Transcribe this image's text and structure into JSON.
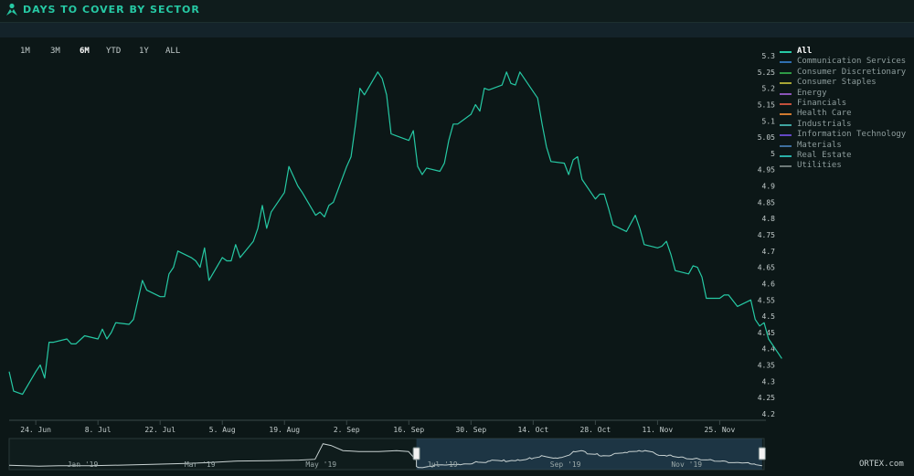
{
  "header": {
    "title": "DAYS TO COVER BY SECTOR"
  },
  "range_buttons": [
    {
      "label": "1M",
      "active": false
    },
    {
      "label": "3M",
      "active": false
    },
    {
      "label": "6M",
      "active": true
    },
    {
      "label": "YTD",
      "active": false
    },
    {
      "label": "1Y",
      "active": false
    },
    {
      "label": "ALL",
      "active": false
    }
  ],
  "legend": [
    {
      "label": "All",
      "color": "#26c9a4",
      "active": true
    },
    {
      "label": "Communication Services",
      "color": "#2f6fb0",
      "active": false
    },
    {
      "label": "Consumer Discretionary",
      "color": "#2e9a46",
      "active": false
    },
    {
      "label": "Consumer Staples",
      "color": "#a8a535",
      "active": false
    },
    {
      "label": "Energy",
      "color": "#8a54b8",
      "active": false
    },
    {
      "label": "Financials",
      "color": "#c2503c",
      "active": false
    },
    {
      "label": "Health Care",
      "color": "#d07a2f",
      "active": false
    },
    {
      "label": "Industrials",
      "color": "#3fa5a0",
      "active": false
    },
    {
      "label": "Information Technology",
      "color": "#6348c4",
      "active": false
    },
    {
      "label": "Materials",
      "color": "#3e6f9f",
      "active": false
    },
    {
      "label": "Real Estate",
      "color": "#2ab0a8",
      "active": false
    },
    {
      "label": "Utilities",
      "color": "#6f7a78",
      "active": false
    }
  ],
  "chart_data": {
    "type": "line",
    "title": "DAYS TO COVER BY SECTOR",
    "xlabel": "",
    "ylabel": "",
    "ylim": [
      4.2,
      5.3
    ],
    "yticks": [
      4.2,
      4.25,
      4.3,
      4.35,
      4.4,
      4.45,
      4.5,
      4.55,
      4.6,
      4.65,
      4.7,
      4.75,
      4.8,
      4.85,
      4.9,
      4.95,
      5,
      5.05,
      5.1,
      5.15,
      5.2,
      5.25,
      5.3
    ],
    "ytick_labels": [
      "4.2",
      "4.25",
      "4.3",
      "4.35",
      "4.4",
      "4.45",
      "4.5",
      "4.55",
      "4.6",
      "4.65",
      "4.7",
      "4.75",
      "4.8",
      "4.85",
      "4.9",
      "4.95",
      "5",
      "5.05",
      "5.1",
      "5.15",
      "5.2",
      "5.25",
      "5.3"
    ],
    "xlim": [
      "2019-06-18",
      "2019-12-05"
    ],
    "x_ticks": [
      {
        "label": "24. Jun",
        "date": "2019-06-24"
      },
      {
        "label": "8. Jul",
        "date": "2019-07-08"
      },
      {
        "label": "22. Jul",
        "date": "2019-07-22"
      },
      {
        "label": "5. Aug",
        "date": "2019-08-05"
      },
      {
        "label": "19. Aug",
        "date": "2019-08-19"
      },
      {
        "label": "2. Sep",
        "date": "2019-09-02"
      },
      {
        "label": "16. Sep",
        "date": "2019-09-16"
      },
      {
        "label": "30. Sep",
        "date": "2019-09-30"
      },
      {
        "label": "14. Oct",
        "date": "2019-10-14"
      },
      {
        "label": "28. Oct",
        "date": "2019-10-28"
      },
      {
        "label": "11. Nov",
        "date": "2019-11-11"
      },
      {
        "label": "25. Nov",
        "date": "2019-11-25"
      }
    ],
    "grid": false,
    "legend_position": "right",
    "series": [
      {
        "name": "All",
        "color": "#26c9a4",
        "points": [
          [
            "2019-06-18",
            4.33
          ],
          [
            "2019-06-19",
            4.27
          ],
          [
            "2019-06-20",
            4.265
          ],
          [
            "2019-06-21",
            4.26
          ],
          [
            "2019-06-24",
            4.33
          ],
          [
            "2019-06-25",
            4.35
          ],
          [
            "2019-06-26",
            4.31
          ],
          [
            "2019-06-27",
            4.42
          ],
          [
            "2019-06-28",
            4.42
          ],
          [
            "2019-07-01",
            4.43
          ],
          [
            "2019-07-02",
            4.415
          ],
          [
            "2019-07-03",
            4.415
          ],
          [
            "2019-07-05",
            4.44
          ],
          [
            "2019-07-08",
            4.43
          ],
          [
            "2019-07-09",
            4.46
          ],
          [
            "2019-07-10",
            4.43
          ],
          [
            "2019-07-11",
            4.45
          ],
          [
            "2019-07-12",
            4.48
          ],
          [
            "2019-07-15",
            4.475
          ],
          [
            "2019-07-16",
            4.49
          ],
          [
            "2019-07-17",
            4.55
          ],
          [
            "2019-07-18",
            4.61
          ],
          [
            "2019-07-19",
            4.58
          ],
          [
            "2019-07-22",
            4.56
          ],
          [
            "2019-07-23",
            4.56
          ],
          [
            "2019-07-24",
            4.63
          ],
          [
            "2019-07-25",
            4.65
          ],
          [
            "2019-07-26",
            4.7
          ],
          [
            "2019-07-29",
            4.68
          ],
          [
            "2019-07-30",
            4.67
          ],
          [
            "2019-07-31",
            4.65
          ],
          [
            "2019-08-01",
            4.71
          ],
          [
            "2019-08-02",
            4.61
          ],
          [
            "2019-08-05",
            4.68
          ],
          [
            "2019-08-06",
            4.67
          ],
          [
            "2019-08-07",
            4.67
          ],
          [
            "2019-08-08",
            4.72
          ],
          [
            "2019-08-09",
            4.68
          ],
          [
            "2019-08-12",
            4.73
          ],
          [
            "2019-08-13",
            4.77
          ],
          [
            "2019-08-14",
            4.84
          ],
          [
            "2019-08-15",
            4.77
          ],
          [
            "2019-08-16",
            4.82
          ],
          [
            "2019-08-19",
            4.88
          ],
          [
            "2019-08-20",
            4.96
          ],
          [
            "2019-08-21",
            4.93
          ],
          [
            "2019-08-22",
            4.9
          ],
          [
            "2019-08-23",
            4.88
          ],
          [
            "2019-08-26",
            4.81
          ],
          [
            "2019-08-27",
            4.82
          ],
          [
            "2019-08-28",
            4.805
          ],
          [
            "2019-08-29",
            4.84
          ],
          [
            "2019-08-30",
            4.85
          ],
          [
            "2019-09-02",
            4.96
          ],
          [
            "2019-09-03",
            4.99
          ],
          [
            "2019-09-04",
            5.09
          ],
          [
            "2019-09-05",
            5.2
          ],
          [
            "2019-09-06",
            5.18
          ],
          [
            "2019-09-09",
            5.25
          ],
          [
            "2019-09-10",
            5.23
          ],
          [
            "2019-09-11",
            5.18
          ],
          [
            "2019-09-12",
            5.06
          ],
          [
            "2019-09-13",
            5.055
          ],
          [
            "2019-09-16",
            5.04
          ],
          [
            "2019-09-17",
            5.07
          ],
          [
            "2019-09-18",
            4.96
          ],
          [
            "2019-09-19",
            4.935
          ],
          [
            "2019-09-20",
            4.955
          ],
          [
            "2019-09-23",
            4.945
          ],
          [
            "2019-09-24",
            4.97
          ],
          [
            "2019-09-25",
            5.04
          ],
          [
            "2019-09-26",
            5.09
          ],
          [
            "2019-09-27",
            5.09
          ],
          [
            "2019-09-30",
            5.12
          ],
          [
            "2019-10-01",
            5.15
          ],
          [
            "2019-10-02",
            5.13
          ],
          [
            "2019-10-03",
            5.2
          ],
          [
            "2019-10-04",
            5.195
          ],
          [
            "2019-10-07",
            5.21
          ],
          [
            "2019-10-08",
            5.25
          ],
          [
            "2019-10-09",
            5.215
          ],
          [
            "2019-10-10",
            5.21
          ],
          [
            "2019-10-11",
            5.25
          ],
          [
            "2019-10-14",
            5.19
          ],
          [
            "2019-10-15",
            5.17
          ],
          [
            "2019-10-16",
            5.09
          ],
          [
            "2019-10-17",
            5.02
          ],
          [
            "2019-10-18",
            4.975
          ],
          [
            "2019-10-21",
            4.97
          ],
          [
            "2019-10-22",
            4.935
          ],
          [
            "2019-10-23",
            4.98
          ],
          [
            "2019-10-24",
            4.99
          ],
          [
            "2019-10-25",
            4.92
          ],
          [
            "2019-10-28",
            4.86
          ],
          [
            "2019-10-29",
            4.875
          ],
          [
            "2019-10-30",
            4.875
          ],
          [
            "2019-10-31",
            4.83
          ],
          [
            "2019-11-01",
            4.78
          ],
          [
            "2019-11-04",
            4.76
          ],
          [
            "2019-11-05",
            4.785
          ],
          [
            "2019-11-06",
            4.81
          ],
          [
            "2019-11-07",
            4.77
          ],
          [
            "2019-11-08",
            4.72
          ],
          [
            "2019-11-11",
            4.71
          ],
          [
            "2019-11-12",
            4.715
          ],
          [
            "2019-11-13",
            4.73
          ],
          [
            "2019-11-14",
            4.69
          ],
          [
            "2019-11-15",
            4.64
          ],
          [
            "2019-11-18",
            4.63
          ],
          [
            "2019-11-19",
            4.655
          ],
          [
            "2019-11-20",
            4.65
          ],
          [
            "2019-11-21",
            4.62
          ],
          [
            "2019-11-22",
            4.555
          ],
          [
            "2019-11-25",
            4.555
          ],
          [
            "2019-11-26",
            4.565
          ],
          [
            "2019-11-27",
            4.565
          ],
          [
            "2019-11-29",
            4.53
          ],
          [
            "2019-12-02",
            4.55
          ],
          [
            "2019-12-03",
            4.49
          ],
          [
            "2019-12-04",
            4.47
          ],
          [
            "2019-12-05",
            4.48
          ],
          [
            "2019-12-06",
            4.43
          ],
          [
            "2019-12-09",
            4.37
          ]
        ]
      }
    ],
    "navigator": {
      "x_ticks": [
        {
          "label": "Jan '19",
          "date": "2019-01-01"
        },
        {
          "label": "Mar '19",
          "date": "2019-03-01"
        },
        {
          "label": "May '19",
          "date": "2019-05-01"
        },
        {
          "label": "Jul '19",
          "date": "2019-07-01"
        },
        {
          "label": "Sep '19",
          "date": "2019-09-01"
        },
        {
          "label": "Nov '19",
          "date": "2019-11-01"
        }
      ],
      "xlim": [
        "2018-11-25",
        "2019-12-10"
      ],
      "ylim": [
        3.8,
        5.6
      ],
      "selected_range": [
        "2019-06-18",
        "2019-12-09"
      ],
      "points": [
        [
          "2018-11-25",
          4.05
        ],
        [
          "2018-12-10",
          4.0
        ],
        [
          "2018-12-20",
          4.03
        ],
        [
          "2019-01-05",
          4.02
        ],
        [
          "2019-01-20",
          4.06
        ],
        [
          "2019-02-05",
          4.1
        ],
        [
          "2019-02-20",
          4.15
        ],
        [
          "2019-03-05",
          4.2
        ],
        [
          "2019-03-20",
          4.3
        ],
        [
          "2019-04-05",
          4.32
        ],
        [
          "2019-04-20",
          4.35
        ],
        [
          "2019-04-28",
          4.4
        ],
        [
          "2019-05-02",
          5.3
        ],
        [
          "2019-05-06",
          5.2
        ],
        [
          "2019-05-12",
          4.9
        ],
        [
          "2019-05-20",
          4.85
        ],
        [
          "2019-05-30",
          4.85
        ],
        [
          "2019-06-08",
          4.9
        ],
        [
          "2019-06-14",
          4.85
        ],
        [
          "2019-06-18",
          4.33
        ]
      ]
    }
  },
  "credit": "ORTEX.com"
}
